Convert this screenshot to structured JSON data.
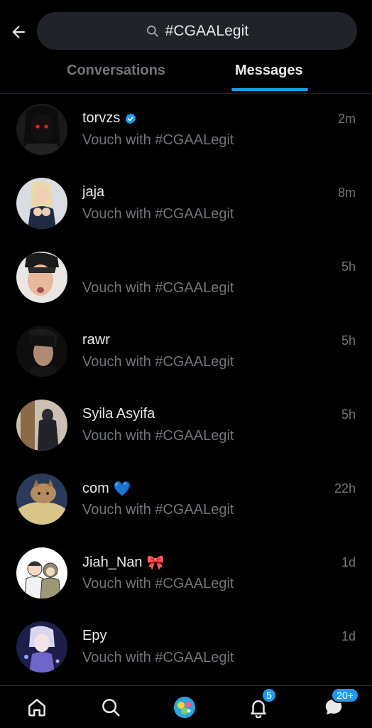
{
  "search": {
    "query": "#CGAALegit"
  },
  "tabs": [
    {
      "label": "Conversations",
      "active": false
    },
    {
      "label": "Messages",
      "active": true
    }
  ],
  "messages": [
    {
      "name": "torvzs",
      "verified": true,
      "snippet": "Vouch with #CGAALegit",
      "time": "2m"
    },
    {
      "name": "jaja",
      "snippet": "Vouch with #CGAALegit",
      "time": "8m"
    },
    {
      "name": "",
      "snippet": "Vouch with #CGAALegit",
      "time": "5h"
    },
    {
      "name": "rawr",
      "snippet": "Vouch with #CGAALegit",
      "time": "5h"
    },
    {
      "name": "Syila Asyifa",
      "snippet": "Vouch with #CGAALegit",
      "time": "5h"
    },
    {
      "name": "com",
      "emoji": "💙",
      "snippet": "Vouch with #CGAALegit",
      "time": "22h"
    },
    {
      "name": "Jiah_Nan",
      "emoji": "🎀",
      "snippet": "Vouch with #CGAALegit",
      "time": "1d"
    },
    {
      "name": "Epy",
      "snippet": "Vouch with #CGAALegit",
      "time": "1d"
    }
  ],
  "nav": {
    "notifications_badge": "5",
    "messages_badge": "20+"
  },
  "colors": {
    "accent": "#1d9bf0",
    "muted": "#71767b",
    "text": "#e7e9ea",
    "background": "#000000"
  }
}
